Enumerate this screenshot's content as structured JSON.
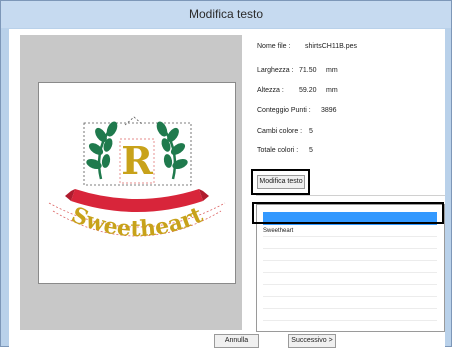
{
  "window": {
    "title": "Modifica testo"
  },
  "info": {
    "file_label": "Nome file :",
    "file_value": "shirtsCH11B.pes",
    "width_label": "Larghezza :",
    "width_value": "71.50",
    "width_unit": "mm",
    "height_label": "Altezza :",
    "height_value": "59.20",
    "height_unit": "mm",
    "stitches_label": "Conteggio Punti :",
    "stitches_value": "3896",
    "color_changes_label": "Cambi colore :",
    "color_changes_value": "5",
    "total_colors_label": "Totale colori :",
    "total_colors_value": "5"
  },
  "buttons": {
    "edit_text": "Modifica testo",
    "cancel": "Annulla",
    "next": "Successivo >"
  },
  "text_list": {
    "input_value": "",
    "items": [
      "Sweetheart"
    ]
  },
  "preview": {
    "monogram": "R",
    "banner_text": "Sweetheart"
  },
  "colors": {
    "leaf_green": "#1f7a4d",
    "gold": "#c8a21a",
    "banner_red": "#d8253a",
    "selection_blue": "#3399ff"
  }
}
